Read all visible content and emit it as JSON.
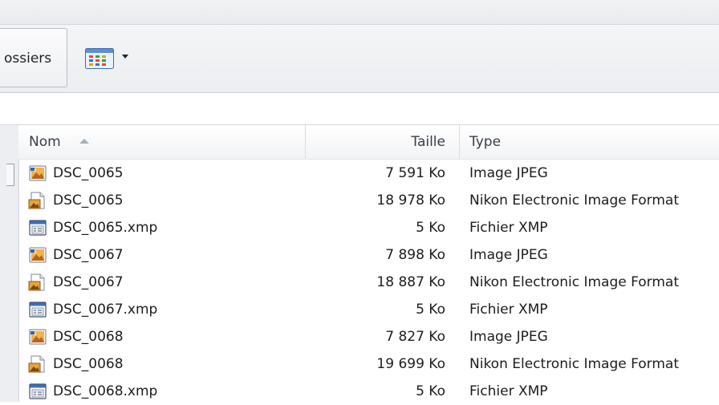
{
  "toolbar": {
    "folders_label": "ossiers",
    "view_icon": "views-grid-icon",
    "view_dropdown_icon": "chevron-down-icon"
  },
  "columns": {
    "name": "Nom",
    "size": "Taille",
    "type": "Type",
    "sort": "ascending"
  },
  "files": [
    {
      "name": "DSC_0065",
      "size": "7 591 Ko",
      "type": "Image JPEG",
      "icon": "jpeg-file-icon"
    },
    {
      "name": "DSC_0065",
      "size": "18 978 Ko",
      "type": "Nikon Electronic Image Format",
      "icon": "nef-file-icon"
    },
    {
      "name": "DSC_0065.xmp",
      "size": "5 Ko",
      "type": "Fichier XMP",
      "icon": "xmp-file-icon"
    },
    {
      "name": "DSC_0067",
      "size": "7 898 Ko",
      "type": "Image JPEG",
      "icon": "jpeg-file-icon"
    },
    {
      "name": "DSC_0067",
      "size": "18 887 Ko",
      "type": "Nikon Electronic Image Format",
      "icon": "nef-file-icon"
    },
    {
      "name": "DSC_0067.xmp",
      "size": "5 Ko",
      "type": "Fichier XMP",
      "icon": "xmp-file-icon"
    },
    {
      "name": "DSC_0068",
      "size": "7 827 Ko",
      "type": "Image JPEG",
      "icon": "jpeg-file-icon"
    },
    {
      "name": "DSC_0068",
      "size": "19 699 Ko",
      "type": "Nikon Electronic Image Format",
      "icon": "nef-file-icon"
    },
    {
      "name": "DSC_0068.xmp",
      "size": "5 Ko",
      "type": "Fichier XMP",
      "icon": "xmp-file-icon"
    }
  ],
  "colors": {
    "toolbar_bg": "#eceef1",
    "header_text": "#3a3e46",
    "row_text": "#1c1c1c"
  }
}
